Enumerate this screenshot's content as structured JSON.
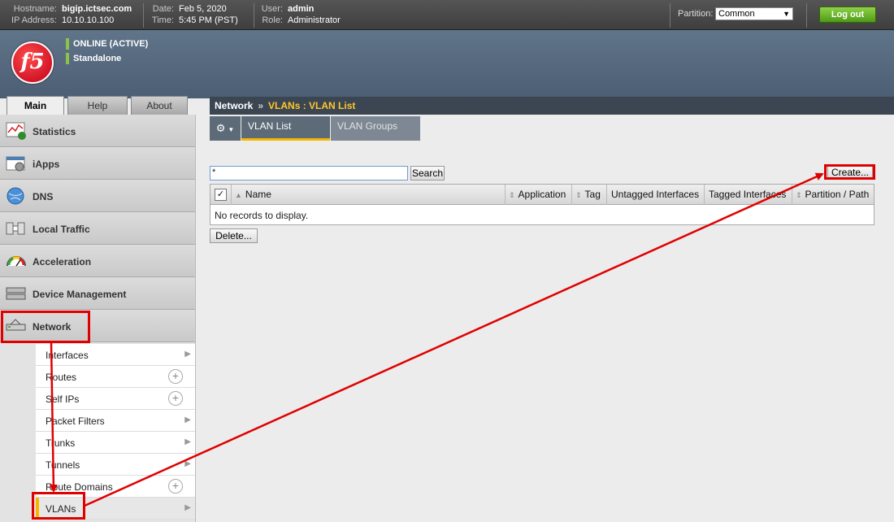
{
  "topbar": {
    "hostname_label": "Hostname:",
    "hostname": "bigip.ictsec.com",
    "ip_label": "IP Address:",
    "ip": "10.10.10.100",
    "date_label": "Date:",
    "date": "Feb 5, 2020",
    "time_label": "Time:",
    "time": "5:45 PM (PST)",
    "user_label": "User:",
    "user": "admin",
    "role_label": "Role:",
    "role": "Administrator",
    "partition_label": "Partition:",
    "partition_value": "Common",
    "logout_label": "Log out"
  },
  "banner": {
    "logo_text": "f5",
    "status": "ONLINE (ACTIVE)",
    "mode": "Standalone",
    "status_color": "#8bc34a"
  },
  "nav_tabs": [
    {
      "label": "Main",
      "active": true
    },
    {
      "label": "Help",
      "active": false
    },
    {
      "label": "About",
      "active": false
    }
  ],
  "sidebar": {
    "items": [
      {
        "label": "Statistics",
        "icon": "statistics-icon"
      },
      {
        "label": "iApps",
        "icon": "iapps-icon"
      },
      {
        "label": "DNS",
        "icon": "dns-globe-icon"
      },
      {
        "label": "Local Traffic",
        "icon": "local-traffic-icon"
      },
      {
        "label": "Acceleration",
        "icon": "acceleration-gauge-icon"
      },
      {
        "label": "Device Management",
        "icon": "device-management-icon"
      },
      {
        "label": "Network",
        "icon": "network-icon"
      }
    ],
    "network_submenu": [
      {
        "label": "Interfaces",
        "action": "chevron"
      },
      {
        "label": "Routes",
        "action": "plus"
      },
      {
        "label": "Self IPs",
        "action": "plus"
      },
      {
        "label": "Packet Filters",
        "action": "chevron"
      },
      {
        "label": "Trunks",
        "action": "chevron"
      },
      {
        "label": "Tunnels",
        "action": "chevron"
      },
      {
        "label": "Route Domains",
        "action": "plus"
      },
      {
        "label": "VLANs",
        "action": "chevron",
        "active": true
      }
    ]
  },
  "breadcrumb": {
    "root": "Network",
    "separator": "»",
    "current": "VLANs : VLAN List"
  },
  "content_tabs": [
    {
      "label": "VLAN List",
      "active": true
    },
    {
      "label": "VLAN Groups",
      "active": false
    }
  ],
  "search": {
    "value": "*",
    "button_label": "Search"
  },
  "create_label": "Create...",
  "table": {
    "columns": [
      "Name",
      "Application",
      "Tag",
      "Untagged Interfaces",
      "Tagged Interfaces",
      "Partition / Path"
    ],
    "empty_message": "No records to display."
  },
  "delete_label": "Delete...",
  "colors": {
    "accent": "#f5b700",
    "annotation": "#e00000",
    "breadcrumb_bg": "#3b4652"
  }
}
